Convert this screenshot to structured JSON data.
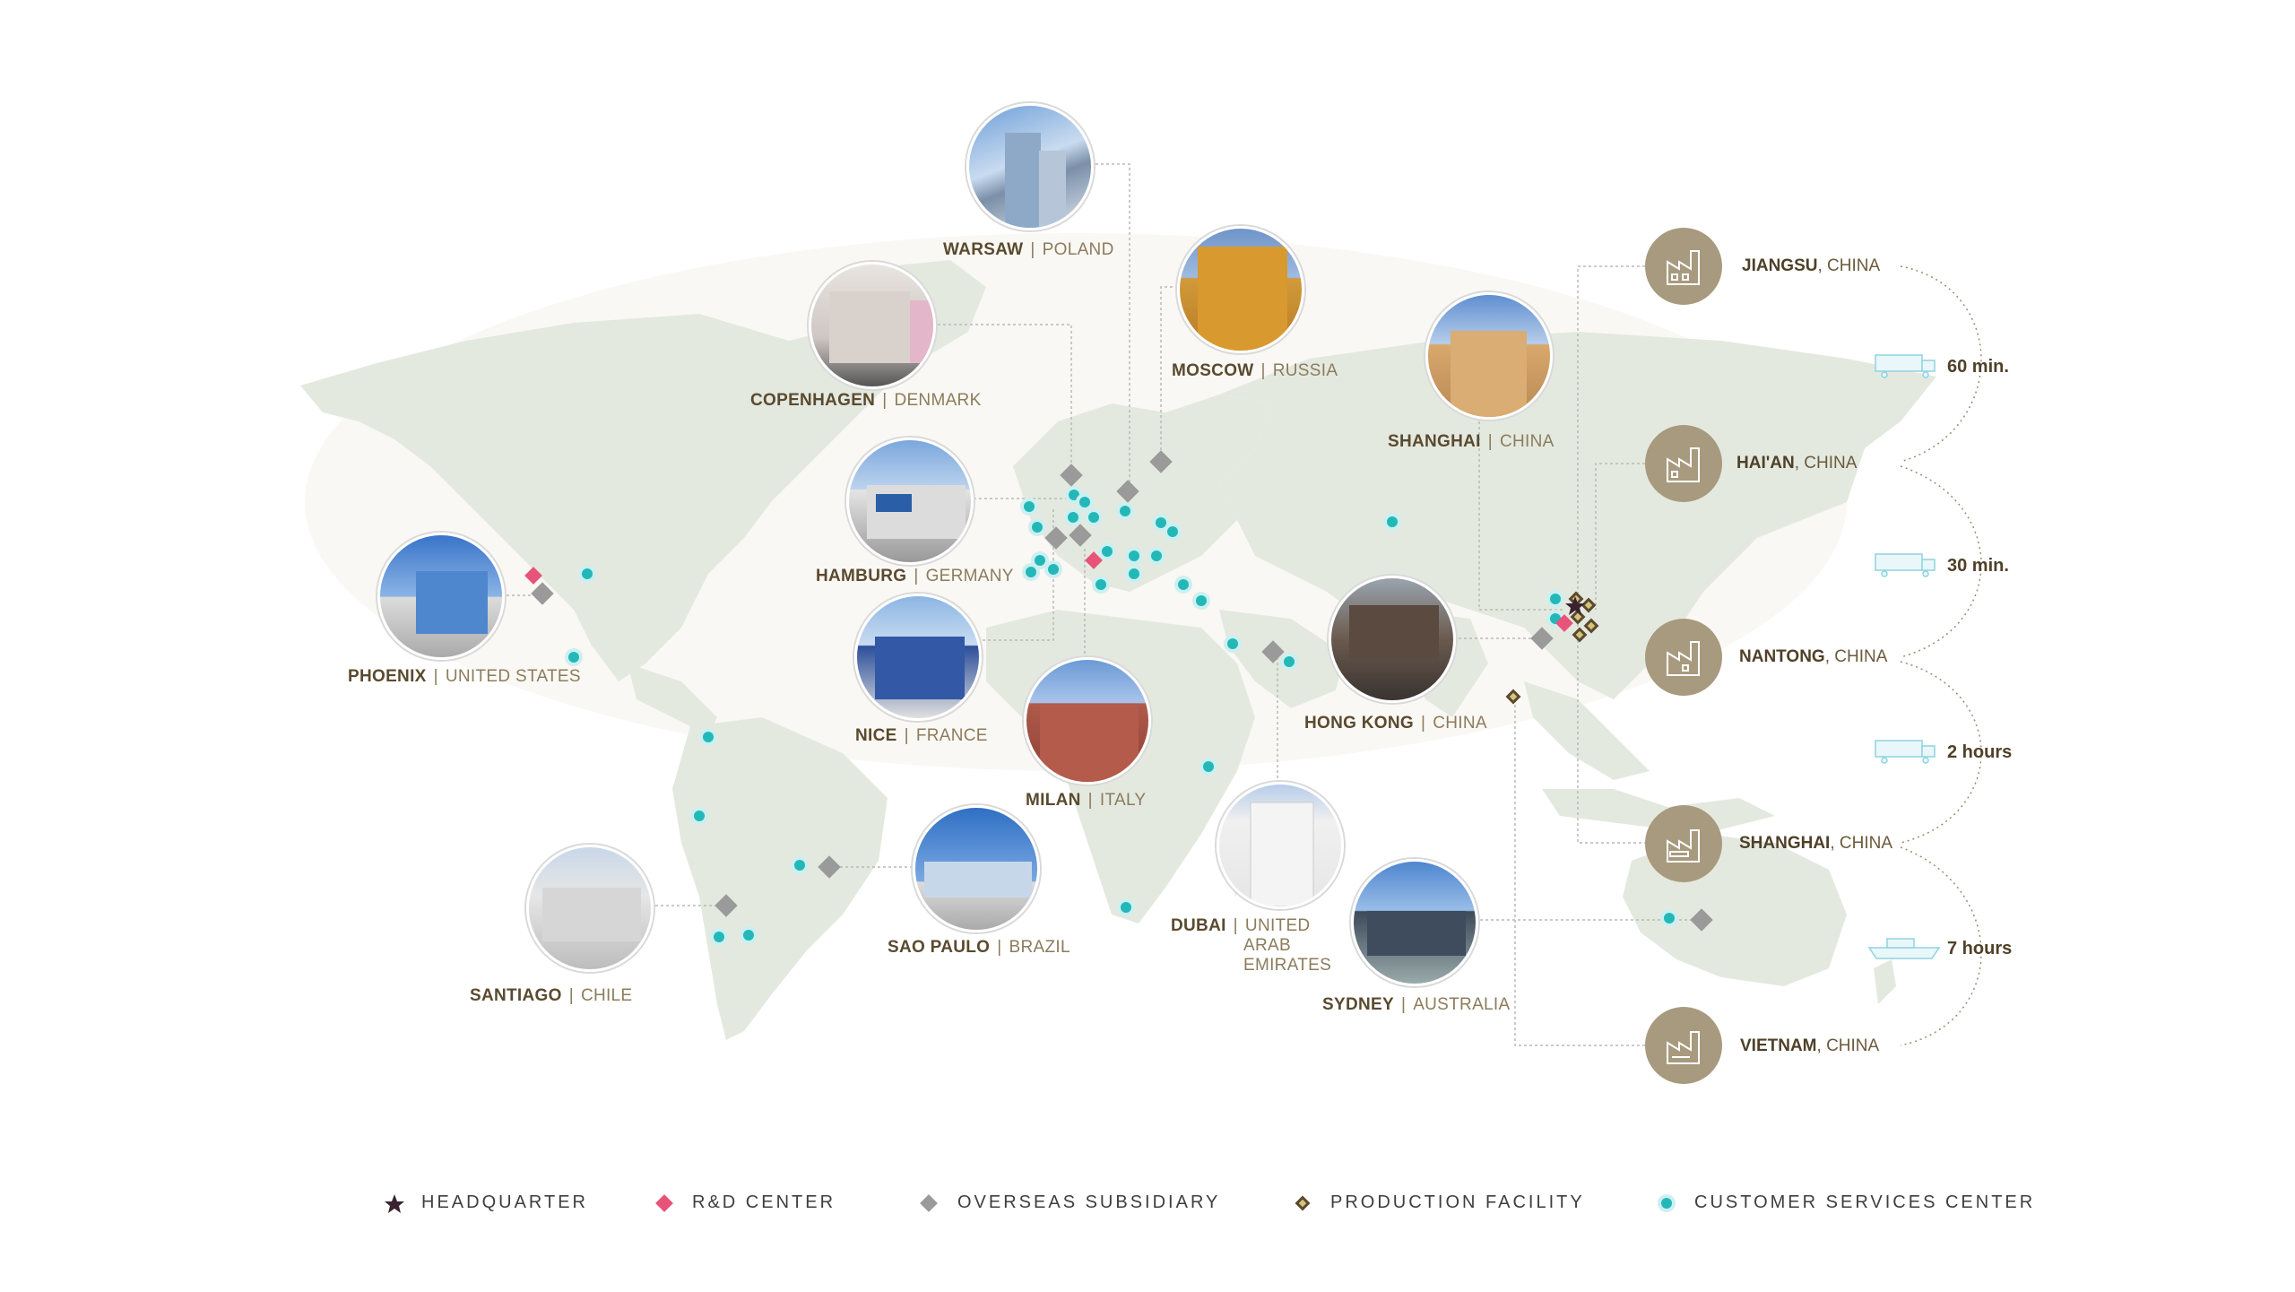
{
  "colors": {
    "land": "#e4e9e0",
    "connector": "#b9b9b9",
    "rd_center": "#e8537a",
    "overseas_subsidiary": "#9a9a9a",
    "production_facility": "#5a4a2e",
    "customer_services": "#23b8b8",
    "headquarter": "#3a2330",
    "factory_circle": "#a89a7e"
  },
  "locations": [
    {
      "city": "WARSAW",
      "country": "POLAND",
      "photo": "office-tower-icon"
    },
    {
      "city": "COPENHAGEN",
      "country": "DENMARK",
      "photo": "townhouse-icon"
    },
    {
      "city": "MOSCOW",
      "country": "RUSSIA",
      "photo": "office-block-icon"
    },
    {
      "city": "SHANGHAI",
      "country": "CHINA",
      "photo": "hotel-icon"
    },
    {
      "city": "HAMBURG",
      "country": "GERMANY",
      "photo": "warehouse-icon"
    },
    {
      "city": "PHOENIX",
      "country": "UNITED STATES",
      "photo": "glass-building-icon"
    },
    {
      "city": "NICE",
      "country": "FRANCE",
      "photo": "blue-building-icon"
    },
    {
      "city": "MILAN",
      "country": "ITALY",
      "photo": "brick-building-icon"
    },
    {
      "city": "HONG KONG",
      "country": "CHINA",
      "photo": "city-building-icon"
    },
    {
      "city": "SAO PAULO",
      "country": "BRAZIL",
      "photo": "modern-office-icon"
    },
    {
      "city": "DUBAI",
      "country": "UNITED ARAB EMIRATES",
      "photo": "white-tower-icon"
    },
    {
      "city": "SANTIAGO",
      "country": "CHILE",
      "photo": "factory-hall-icon"
    },
    {
      "city": "SYDNEY",
      "country": "AUSTRALIA",
      "photo": "showroom-icon"
    }
  ],
  "dubai_country_lines": [
    "UNITED",
    "ARAB",
    "EMIRATES"
  ],
  "factories": [
    {
      "city": "JIANGSU",
      "country": "CHINA"
    },
    {
      "city": "HAI'AN",
      "country": "CHINA"
    },
    {
      "city": "NANTONG",
      "country": "CHINA"
    },
    {
      "city": "SHANGHAI",
      "country": "CHINA"
    },
    {
      "city": "VIETNAM",
      "country": "CHINA"
    }
  ],
  "transit": [
    {
      "mode": "truck-icon",
      "duration": "60 min."
    },
    {
      "mode": "truck-icon",
      "duration": "30 min."
    },
    {
      "mode": "truck-icon",
      "duration": "2 hours"
    },
    {
      "mode": "ship-icon",
      "duration": "7 hours"
    }
  ],
  "legend": [
    {
      "key": "headquarter",
      "label": "HEADQUARTER"
    },
    {
      "key": "rd_center",
      "label": "R&D CENTER"
    },
    {
      "key": "overseas_subsidiary",
      "label": "OVERSEAS SUBSIDIARY"
    },
    {
      "key": "production_facility",
      "label": "PRODUCTION FACILITY"
    },
    {
      "key": "customer_services",
      "label": "CUSTOMER SERVICES CENTER"
    }
  ]
}
